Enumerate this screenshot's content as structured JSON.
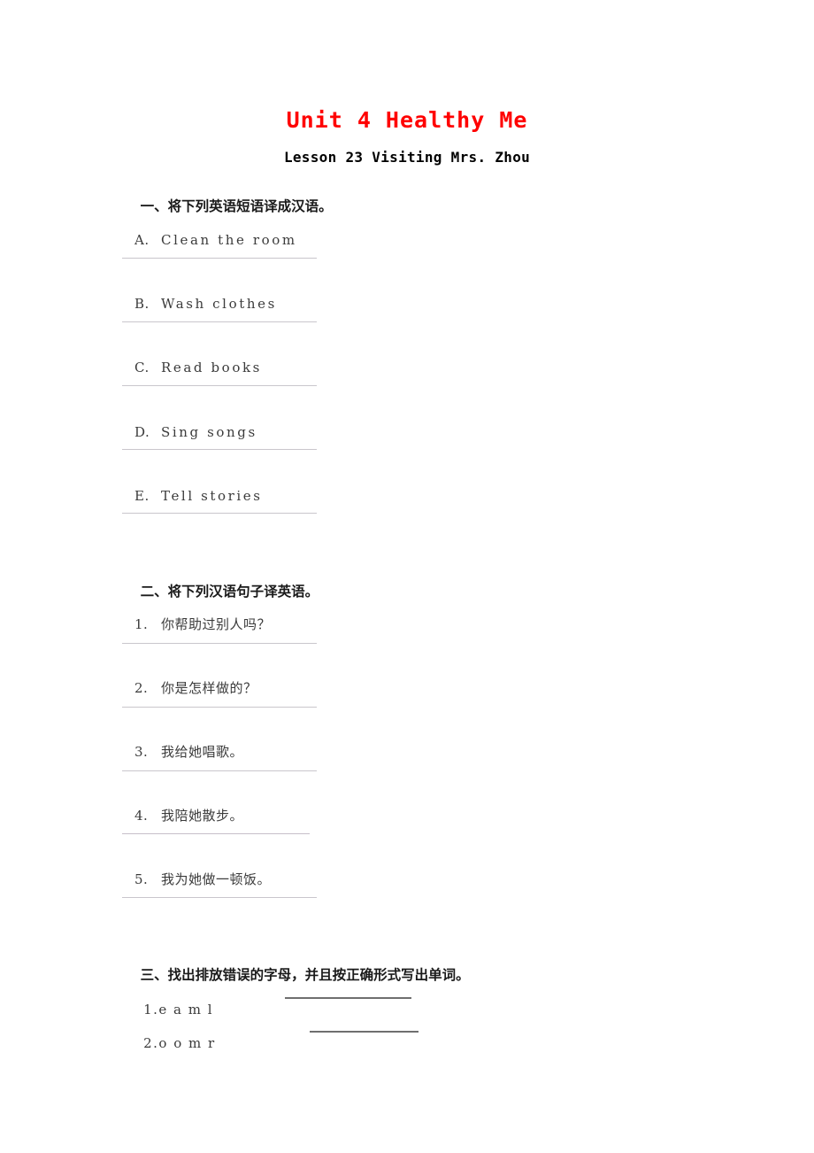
{
  "document": {
    "title": "Unit 4 Healthy Me",
    "subtitle": "Lesson 23 Visiting Mrs. Zhou",
    "title_color": "#ff0000",
    "body_color": "#3b3b3b",
    "rule_color": "#c9c6cc",
    "blank_color": "#6f6f6f"
  },
  "sections": [
    {
      "number": "一、",
      "heading": "将下列英语短语译成汉语。",
      "items": [
        {
          "marker": "A.",
          "text": "Clean the room"
        },
        {
          "marker": "B.",
          "text": "Wash clothes"
        },
        {
          "marker": "C.",
          "text": "Read books"
        },
        {
          "marker": "D.",
          "text": "Sing songs"
        },
        {
          "marker": "E.",
          "text": "Tell stories"
        }
      ]
    },
    {
      "number": "二、",
      "heading": "将下列汉语句子译英语。",
      "items": [
        {
          "marker": "1.",
          "text": "你帮助过别人吗？"
        },
        {
          "marker": "2.",
          "text": "你是怎样做的？"
        },
        {
          "marker": "3.",
          "text": "我给她唱歌。"
        },
        {
          "marker": "4.",
          "text": "我陪她散步。"
        },
        {
          "marker": "5.",
          "text": "我为她做一顿饭。"
        }
      ]
    },
    {
      "number": "三、",
      "heading": "找出排放错误的字母，并且按正确形式写出单词。",
      "items": [
        {
          "marker": "1.",
          "text": "e a m l",
          "answer": ""
        },
        {
          "marker": "2.",
          "text": "o o m r",
          "answer": ""
        }
      ]
    }
  ]
}
